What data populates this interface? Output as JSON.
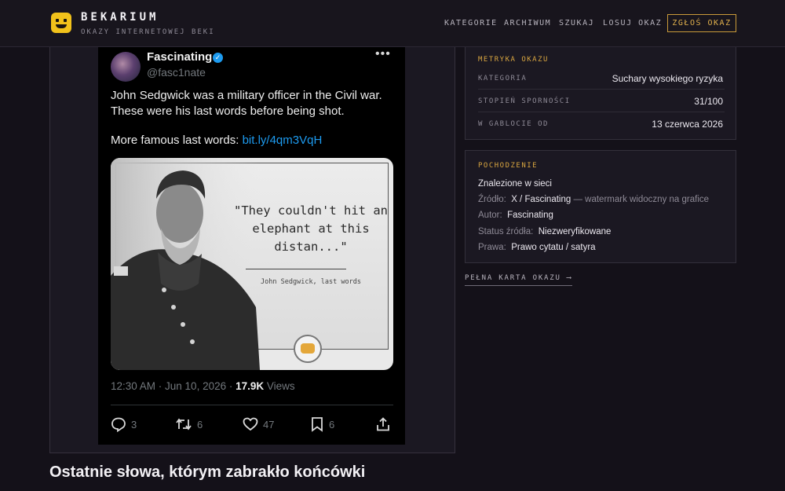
{
  "header": {
    "brand": "BEKARIUM",
    "tagline": "OKAZY INTERNETOWEJ BEKI",
    "nav": [
      "KATEGORIE",
      "ARCHIWUM",
      "SZUKAJ",
      "LOSUJ OKAZ"
    ],
    "report_label": "ZGŁOŚ OKAZ",
    "accent": "#e1b14d",
    "logo_color": "#f1c21b"
  },
  "tweet": {
    "author": "Fascinating",
    "handle": "@fasc1nate",
    "more": "•••",
    "text": "John Sedgwick was a military officer in the Civil war. These were his last words before being shot.",
    "link_prefix": "More famous last words: ",
    "link": "bit.ly/4qm3VqH",
    "image_quote": "\"They couldn't hit an elephant at this distan...\"",
    "image_attribution": "John Sedgwick, last words",
    "timestamp": "12:30 AM · Jun 10, 2026 · ",
    "views_count": "17.9K",
    "views_label": " Views",
    "replies": "3",
    "reposts": "6",
    "likes": "47",
    "bookmarks": "6",
    "link_color": "#1d9bf0"
  },
  "caption": "Ostatnie słowa, którym zabrakło końcówki",
  "metrics": {
    "title": "METRYKA OKAZU",
    "rows": [
      {
        "label": "KATEGORIA",
        "value": "Suchary wysokiego ryzyka"
      },
      {
        "label": "STOPIEŃ SPORNOŚCI",
        "value": "31/100"
      },
      {
        "label": "W GABLOCIE OD",
        "value": "13 czerwca 2026"
      }
    ]
  },
  "origin": {
    "title": "POCHODZENIE",
    "found": "Znalezione w sieci",
    "source_label": "Źródło:",
    "source_value": "X / Fascinating",
    "source_note": " — watermark widoczny na grafice",
    "author_label": "Autor:",
    "author_value": "Fascinating",
    "status_label": "Status źródła:",
    "status_value": "Niezweryfikowane",
    "rights_label": "Prawa:",
    "rights_value": "Prawo cytatu / satyra"
  },
  "full_card_link": "PEŁNA KARTA OKAZU ⟶"
}
